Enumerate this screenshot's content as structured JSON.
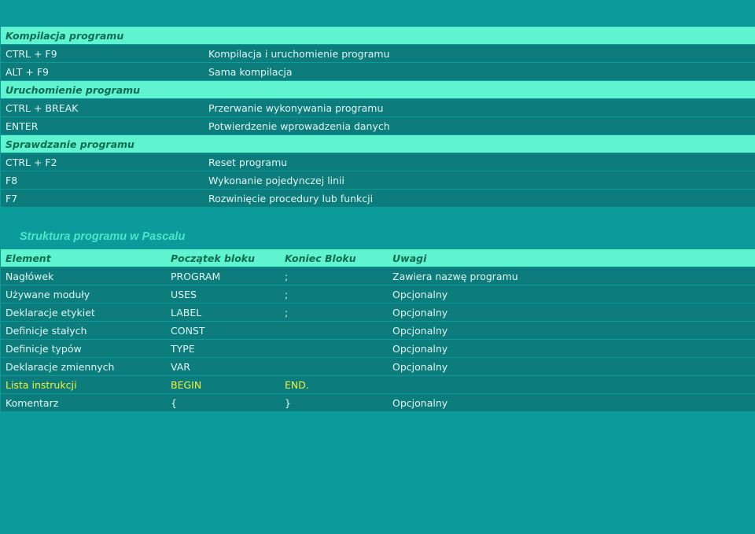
{
  "shortcuts": {
    "rows": [
      {
        "type": "head",
        "key": "Kompilacja programu"
      },
      {
        "type": "data",
        "key": "CTRL + F9",
        "desc": "Kompilacja i uruchomienie programu"
      },
      {
        "type": "data",
        "key": "ALT + F9",
        "desc": "Sama kompilacja"
      },
      {
        "type": "head",
        "key": "Uruchomienie programu"
      },
      {
        "type": "data",
        "key": "CTRL + BREAK",
        "desc": "Przerwanie wykonywania programu"
      },
      {
        "type": "data",
        "key": "ENTER",
        "desc": "Potwierdzenie wprowadzenia danych"
      },
      {
        "type": "head",
        "key": "Sprawdzanie programu"
      },
      {
        "type": "data",
        "key": "CTRL + F2",
        "desc": "Reset programu"
      },
      {
        "type": "data",
        "key": "F8",
        "desc": "Wykonanie pojedynczej linii"
      },
      {
        "type": "data",
        "key": "F7",
        "desc": "Rozwinięcie procedury lub funkcji"
      }
    ]
  },
  "structure": {
    "title": "Struktura programu w Pascalu",
    "headers": [
      "Element",
      "Początek bloku",
      "Koniec Bloku",
      "Uwagi"
    ],
    "rows": [
      [
        "Nagłówek",
        "PROGRAM",
        ";",
        "Zawiera nazwę programu"
      ],
      [
        "Używane moduły",
        "USES",
        ";",
        "Opcjonalny"
      ],
      [
        "Deklaracje etykiet",
        "LABEL",
        ";",
        "Opcjonalny"
      ],
      [
        "Definicje stałych",
        "CONST",
        "",
        "Opcjonalny"
      ],
      [
        "Definicje typów",
        "TYPE",
        "",
        "Opcjonalny"
      ],
      [
        "Deklaracje zmiennych",
        "VAR",
        "",
        "Opcjonalny"
      ],
      [
        "Lista instrukcji",
        "BEGIN",
        "END.",
        ""
      ],
      [
        "Komentarz",
        "{",
        "}",
        "Opcjonalny"
      ]
    ],
    "highlight_row": 6
  },
  "colors": {
    "background": "#0b9b9b",
    "header_row": "#5ff4cf",
    "data_row": "#0d7c7c",
    "highlight_text": "#f2f23a"
  }
}
